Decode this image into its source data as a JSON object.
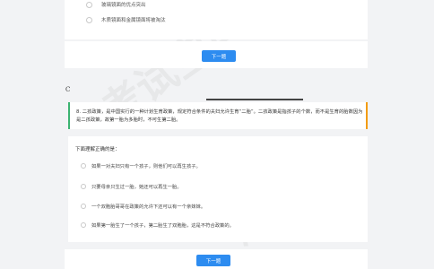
{
  "prev_question": {
    "options": [
      "玻璃镜面的优点突出",
      "木质镜面和金属镜面将被淘汰"
    ],
    "next_label": "下一题"
  },
  "letter": "C",
  "question": {
    "number": "8.",
    "stem": "二孩政策，是中国实行的一种计划生育政策，规定符合条件的夫妇允许生育“二胎”。二孩政策是指孩子的个数，而不是生育的胎数因为是二孩政策，故第一胎为多胎时，不可生第二胎。",
    "prompt": "下面理解正确的是：",
    "choices": [
      "如果一对夫妇只有一个孩子，则他们可以再生孩子。",
      "只要母亲只生过一胎，她还可以再生一胎。",
      "一个双胞胎哥哥在政策的允许下还可以有一个亲妹妹。",
      "如果第一胎生了一个孩子，第二胎生了双胞胎，这是不符合政策的。"
    ],
    "next_label": "下一题"
  },
  "watermarks": [
    "考试宝典",
    "海克"
  ]
}
